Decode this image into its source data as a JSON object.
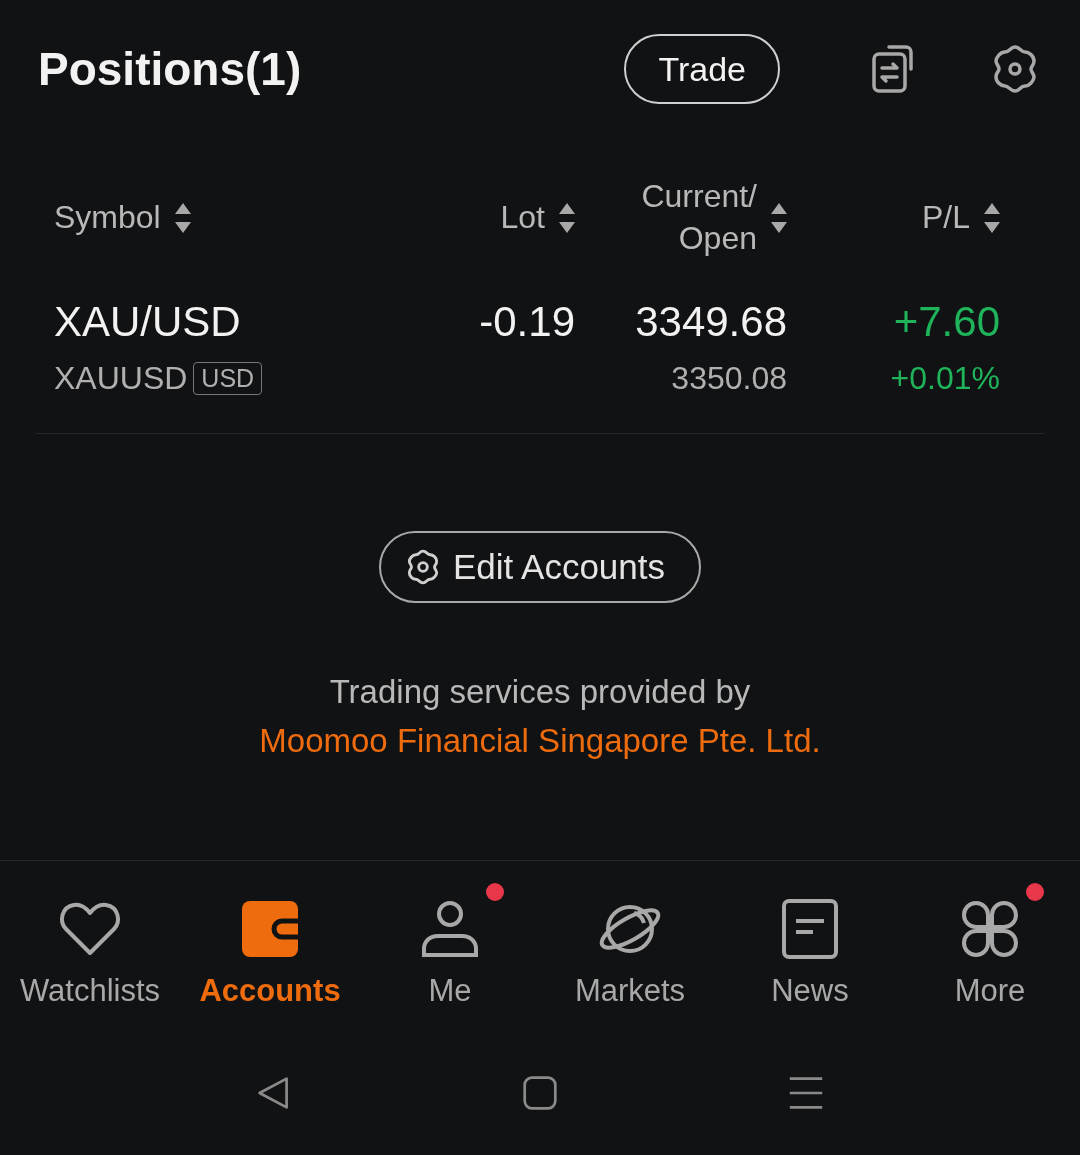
{
  "header": {
    "title": "Positions(1)",
    "trade_button": "Trade"
  },
  "table": {
    "columns": [
      {
        "label": "Symbol",
        "sortable": true
      },
      {
        "label": "Lot",
        "sortable": true
      },
      {
        "label": "Current/ Open",
        "sortable": true
      },
      {
        "label": "P/L",
        "sortable": true
      }
    ],
    "rows": [
      {
        "symbol": "XAU/USD",
        "code": "XAUUSD",
        "currency": "USD",
        "lot": "-0.19",
        "current": "3349.68",
        "open": "3350.08",
        "pl": "+7.60",
        "pl_percent": "+0.01%",
        "positive": true
      }
    ]
  },
  "edit_accounts": "Edit Accounts",
  "disclaimer": {
    "text": "Trading services provided by",
    "link": "Moomoo Financial Singapore Pte. Ltd."
  },
  "nav": [
    {
      "label": "Watchlists",
      "kind": "heart",
      "selected": false,
      "badge": false
    },
    {
      "label": "Accounts",
      "kind": "wallet",
      "selected": true,
      "badge": false
    },
    {
      "label": "Me",
      "kind": "person",
      "selected": false,
      "badge": true
    },
    {
      "label": "Markets",
      "kind": "planet",
      "selected": false,
      "badge": false
    },
    {
      "label": "News",
      "kind": "document",
      "selected": false,
      "badge": false
    },
    {
      "label": "More",
      "kind": "grid",
      "selected": false,
      "badge": true
    }
  ]
}
